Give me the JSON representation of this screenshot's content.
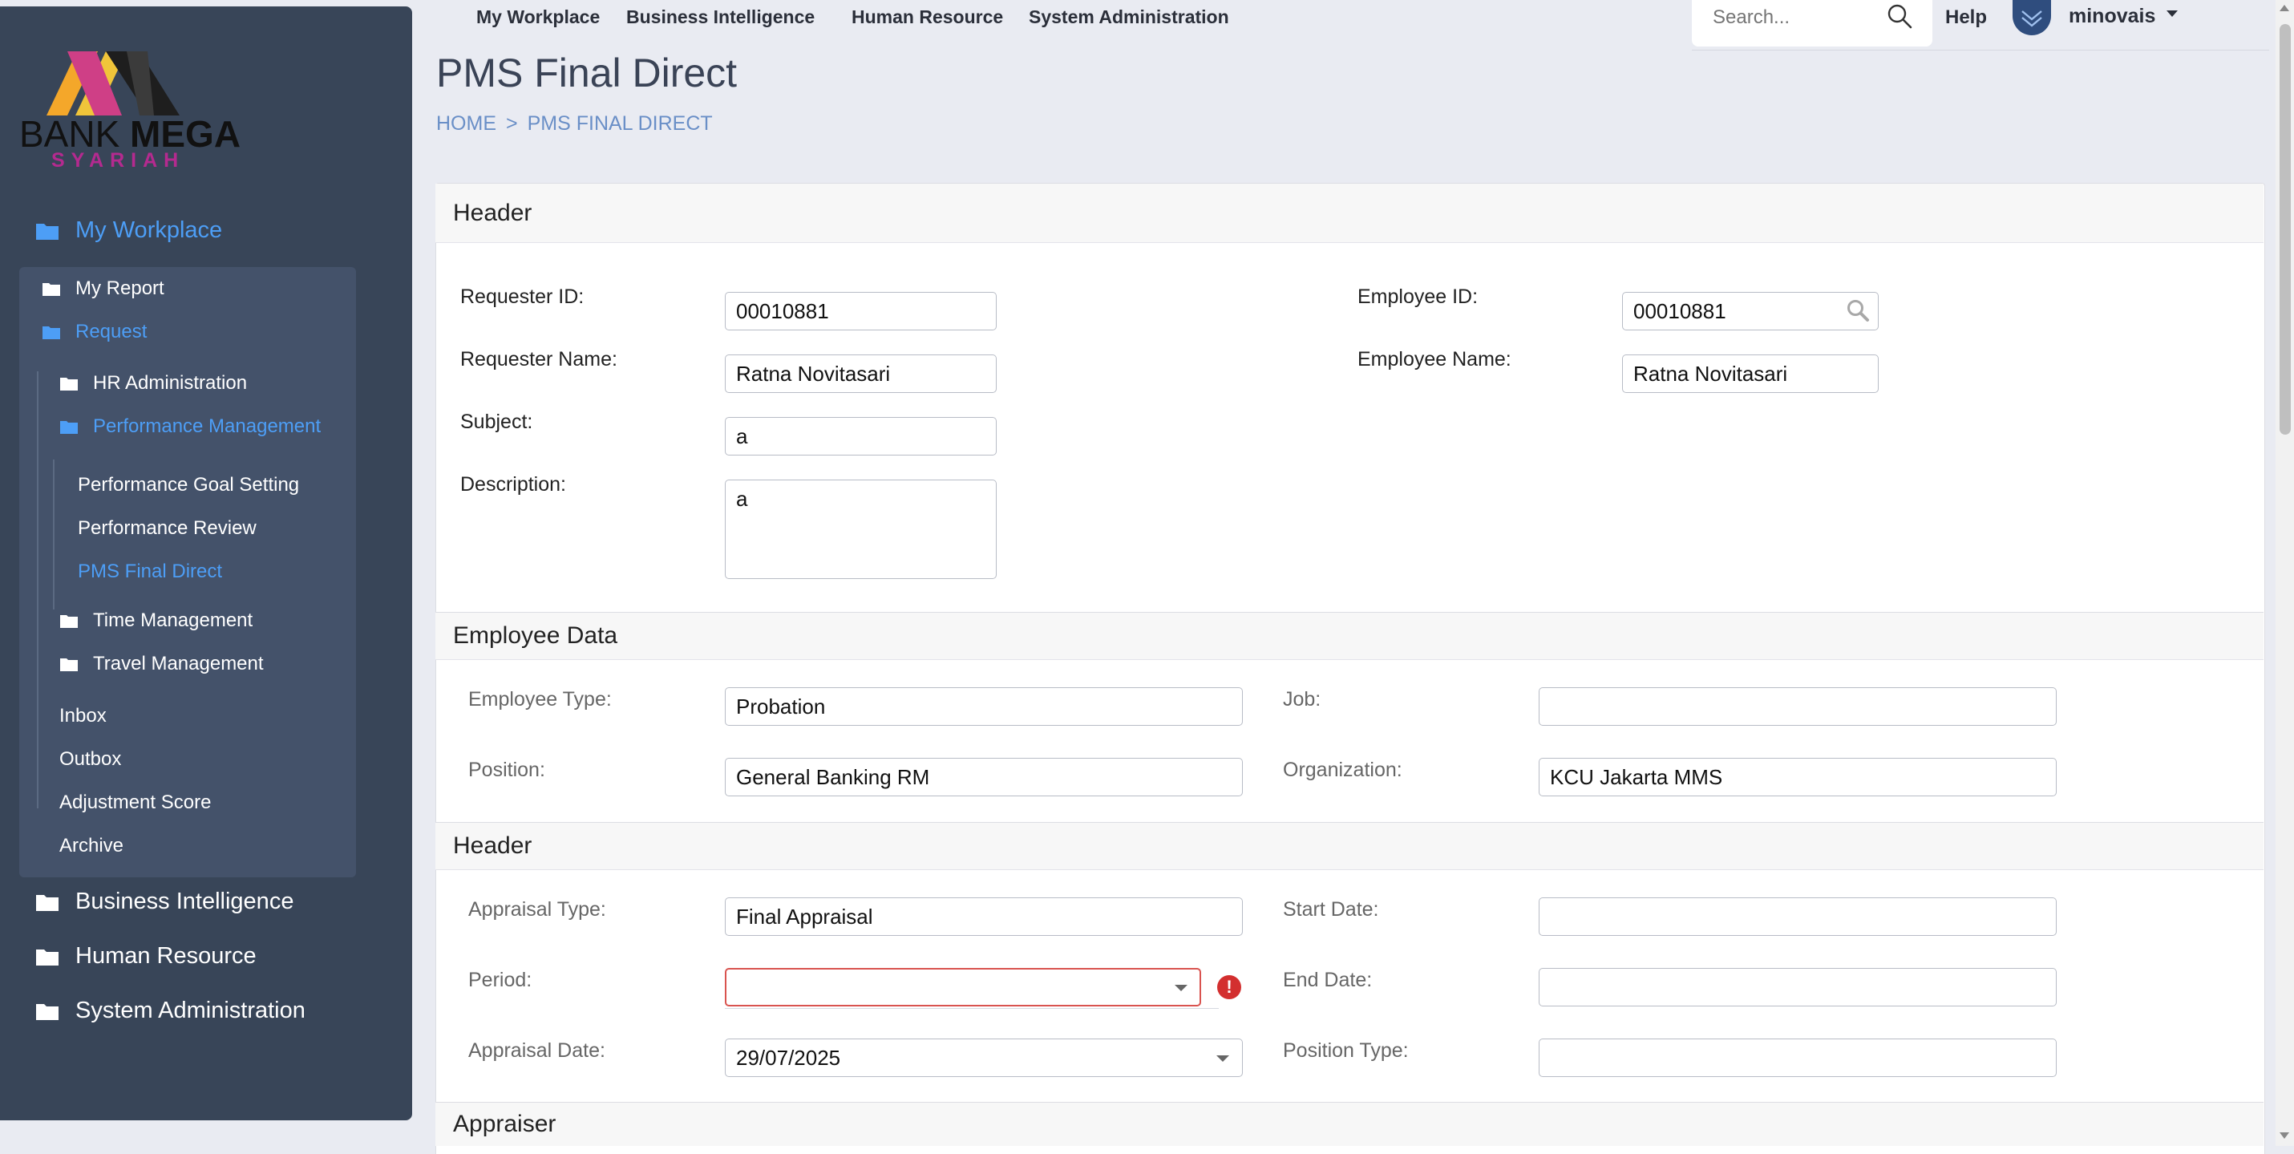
{
  "brand": {
    "name_light": "BANK ",
    "name_bold": "MEGA",
    "sub": "SYARIAH"
  },
  "topnav": [
    "My Workplace",
    "Business Intelligence",
    "Human Resource",
    "System Administration"
  ],
  "search": {
    "placeholder": "Search..."
  },
  "help_label": "Help",
  "user": {
    "name": "minovais"
  },
  "page": {
    "title": "PMS Final Direct",
    "breadcrumb": [
      "HOME",
      "PMS FINAL DIRECT"
    ],
    "breadcrumb_sep": ">"
  },
  "sidebar": {
    "my_workplace": "My Workplace",
    "my_report": "My Report",
    "request": "Request",
    "hr_administration": "HR Administration",
    "performance_management": "Performance Management",
    "perf_children": [
      "Performance Goal Setting",
      "Performance Review",
      "PMS Final Direct"
    ],
    "time_management": "Time Management",
    "travel_management": "Travel Management",
    "inbox": "Inbox",
    "outbox": "Outbox",
    "adjustment_score": "Adjustment Score",
    "archive": "Archive",
    "business_intelligence": "Business Intelligence",
    "human_resource": "Human Resource",
    "system_administration": "System Administration"
  },
  "header_section": {
    "title": "Header",
    "requester_id_label": "Requester ID:",
    "requester_id": "00010881",
    "requester_name_label": "Requester Name:",
    "requester_name": "Ratna Novitasari",
    "subject_label": "Subject:",
    "subject": "a",
    "description_label": "Description:",
    "description": "a",
    "employee_id_label": "Employee ID:",
    "employee_id": "00010881",
    "employee_name_label": "Employee Name:",
    "employee_name": "Ratna Novitasari"
  },
  "employee_data": {
    "title": "Employee Data",
    "employee_type_label": "Employee Type:",
    "employee_type": "Probation",
    "job_label": "Job:",
    "job": "",
    "position_label": "Position:",
    "position": "General Banking RM",
    "organization_label": "Organization:",
    "organization": "KCU Jakarta MMS"
  },
  "appraisal_header": {
    "title": "Header",
    "appraisal_type_label": "Appraisal Type:",
    "appraisal_type": "Final Appraisal",
    "start_date_label": "Start Date:",
    "start_date": "",
    "period_label": "Period:",
    "period": "",
    "end_date_label": "End Date:",
    "end_date": "",
    "appraisal_date_label": "Appraisal Date:",
    "appraisal_date": "29/07/2025",
    "position_type_label": "Position Type:",
    "position_type": ""
  },
  "appraiser_section": {
    "title": "Appraiser"
  },
  "error_mark": "!"
}
